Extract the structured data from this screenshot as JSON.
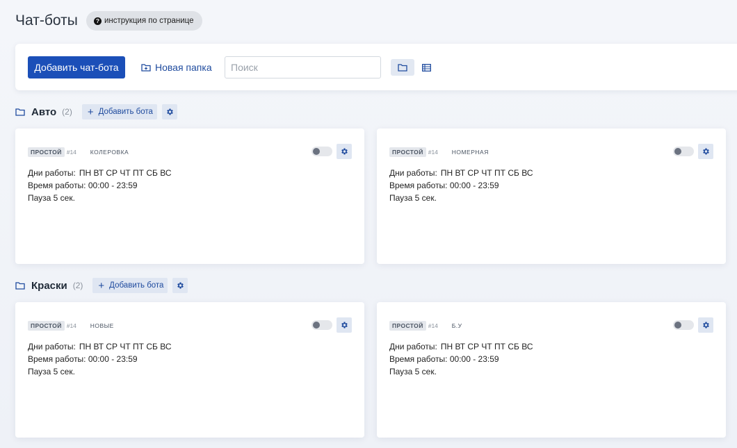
{
  "page": {
    "title": "Чат-боты",
    "help_label": "инструкция по странице"
  },
  "toolbar": {
    "add_bot_label": "Добавить чат-бота",
    "new_folder_label": "Новая папка",
    "search_placeholder": "Поиск",
    "views": [
      {
        "icon": "folder-icon",
        "active": true
      },
      {
        "icon": "table-list-icon",
        "active": false
      }
    ]
  },
  "folders": [
    {
      "name": "Авто",
      "count": "(2)",
      "add_label": "Добавить бота",
      "bots": [
        {
          "type": "ПРОСТОЙ",
          "id": "#14",
          "name": "КОЛЕРОВКА",
          "days_label": "Дни работы:",
          "days": "ПН ВТ СР ЧТ ПТ СБ ВС",
          "time": "Время работы: 00:00 - 23:59",
          "pause": "Пауза 5 сек.",
          "enabled": false
        },
        {
          "type": "ПРОСТОЙ",
          "id": "#14",
          "name": "НОМЕРНАЯ",
          "days_label": "Дни работы:",
          "days": "ПН ВТ СР ЧТ ПТ СБ ВС",
          "time": "Время работы: 00:00 - 23:59",
          "pause": "Пауза 5 сек.",
          "enabled": false
        }
      ]
    },
    {
      "name": "Краски",
      "count": "(2)",
      "add_label": "Добавить бота",
      "bots": [
        {
          "type": "ПРОСТОЙ",
          "id": "#14",
          "name": "НОВЫЕ",
          "days_label": "Дни работы:",
          "days": "ПН ВТ СР ЧТ ПТ СБ ВС",
          "time": "Время работы: 00:00 - 23:59",
          "pause": "Пауза 5 сек.",
          "enabled": false
        },
        {
          "type": "ПРОСТОЙ",
          "id": "#14",
          "name": "Б.У",
          "days_label": "Дни работы:",
          "days": "ПН ВТ СР ЧТ ПТ СБ ВС",
          "time": "Время работы: 00:00 - 23:59",
          "pause": "Пауза 5 сек.",
          "enabled": false
        }
      ]
    }
  ],
  "colors": {
    "primary": "#1b4fb8",
    "link": "#1f4b9e",
    "chip_bg": "#dfe6f2",
    "background": "#f4f6fa"
  }
}
